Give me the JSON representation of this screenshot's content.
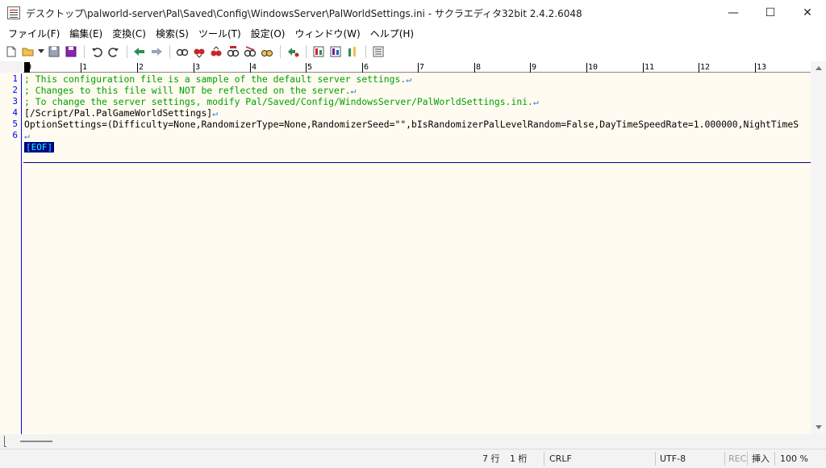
{
  "window": {
    "title": "デスクトップ\\palworld-server\\Pal\\Saved\\Config\\WindowsServer\\PalWorldSettings.ini - サクラエディタ32bit 2.4.2.6048",
    "controls": {
      "minimize": "—",
      "maximize": "☐",
      "close": "✕"
    }
  },
  "menu": [
    {
      "label": "ファイル(F)"
    },
    {
      "label": "編集(E)"
    },
    {
      "label": "変換(C)"
    },
    {
      "label": "検索(S)"
    },
    {
      "label": "ツール(T)"
    },
    {
      "label": "設定(O)"
    },
    {
      "label": "ウィンドウ(W)"
    },
    {
      "label": "ヘルプ(H)"
    }
  ],
  "toolbar": {
    "icons": [
      "new-file-icon",
      "open-file-icon",
      "open-dropdown-icon",
      "save-icon",
      "save-as-icon",
      "undo-icon",
      "redo-icon",
      "jump-back-icon",
      "jump-forward-icon",
      "search-icon",
      "search-prev-icon",
      "search-next-icon",
      "replace-icon",
      "grep-icon",
      "mark-icon",
      "compare-icon",
      "outline-icon",
      "function-list-icon",
      "settings-icon",
      "window-list-icon"
    ],
    "accent_colors": {
      "green": "#2e8b57",
      "red": "#c62828",
      "purple": "#7b1fa2"
    }
  },
  "ruler": {
    "labels": [
      "0",
      "1",
      "2",
      "3",
      "4",
      "5",
      "6",
      "7",
      "8",
      "9",
      "10",
      "11",
      "12",
      "13"
    ]
  },
  "editor": {
    "line_numbers": [
      "1",
      "2",
      "3",
      "4",
      "5",
      "6"
    ],
    "lines": [
      {
        "text": "; This configuration file is a sample of the default server settings.",
        "style": "comment"
      },
      {
        "text": "; Changes to this file will NOT be reflected on the server.",
        "style": "comment"
      },
      {
        "text": "; To change the server settings, modify Pal/Saved/Config/WindowsServer/PalWorldSettings.ini.",
        "style": "comment"
      },
      {
        "text": "[/Script/Pal.PalGameWorldSettings]",
        "style": "normal"
      },
      {
        "text": "OptionSettings=(Difficulty=None,RandomizerType=None,RandomizerSeed=\"\",bIsRandomizerPalLevelRandom=False,DayTimeSpeedRate=1.000000,NightTimeS",
        "style": "normal"
      },
      {
        "text": "",
        "style": "normal"
      }
    ],
    "eol_mark": "↵",
    "eof_mark": "[EOF]",
    "colors": {
      "background": "#fffbf0",
      "comment": "#00a000",
      "line_number": "#0000ff",
      "eof_bg": "#000080",
      "eof_fg": "#00ffff"
    }
  },
  "status": {
    "line": "7 行",
    "column": "1 桁",
    "line_ending": "CRLF",
    "encoding": "UTF-8",
    "rec": "REC",
    "insert_mode": "挿入",
    "zoom": "100 %"
  }
}
